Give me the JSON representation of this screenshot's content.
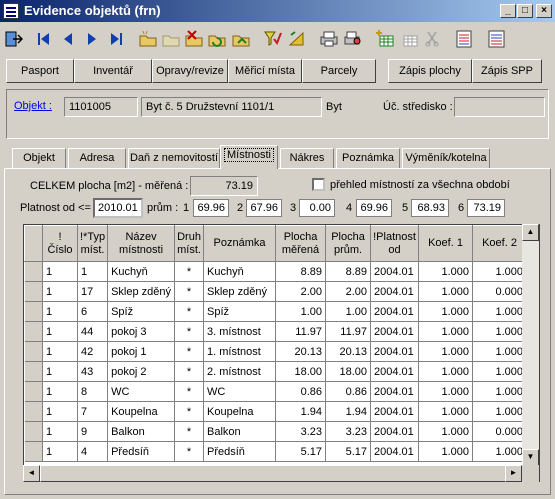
{
  "window": {
    "title": "Evidence objektů (frn)"
  },
  "toolbar": {
    "icons": [
      "exit-icon",
      "first-record-icon",
      "prev-record-icon",
      "next-record-icon",
      "last-record-icon",
      "new-folder-icon",
      "open-folder-icon",
      "delete-folder-icon",
      "refresh-icon",
      "redo-icon",
      "filter-icon",
      "sort-icon",
      "print-icon",
      "print-preview-icon",
      "add-table-icon",
      "table-icon",
      "cut-icon",
      "list-icon",
      "export-icon"
    ]
  },
  "nav_buttons": [
    "Pasport",
    "Inventář",
    "Opravy/revize",
    "Měřicí místa",
    "Parcely",
    "Zápis plochy",
    "Zápis SPP"
  ],
  "object": {
    "label": "Objekt :",
    "code": "1101005",
    "name": "Byt č.  5 Družstevní 1101/1",
    "type": "Byt",
    "cost_center_label": "Úč. středisko :",
    "cost_center_value": ""
  },
  "tabs": [
    "Objekt",
    "Adresa",
    "Daň z nemovitostí",
    "Místnosti",
    "Nákres",
    "Poznámka",
    "Výměník/kotelna"
  ],
  "active_tab": "Místnosti",
  "summary": {
    "total_label": "CELKEM plocha [m2] - měřená :",
    "total_value": "73.19",
    "overview_label": "přehled místností za všechna období",
    "validity_label": "Platnost od <=",
    "validity_value": "2010.01",
    "avg_label": "prům :",
    "averages": [
      {
        "n": "1",
        "v": "69.96"
      },
      {
        "n": "2",
        "v": "67.96"
      },
      {
        "n": "3",
        "v": "0.00"
      },
      {
        "n": "4",
        "v": "69.96"
      },
      {
        "n": "5",
        "v": "68.93"
      },
      {
        "n": "6",
        "v": "73.19"
      }
    ]
  },
  "grid": {
    "columns": [
      "! Číslo",
      "!*Typ míst.",
      "Název místnosti",
      "Druh míst.",
      "Poznámka",
      "Plocha měřená",
      "Plocha prům.",
      "!Platnost od",
      "Koef. 1",
      "Koef. 2"
    ],
    "rows": [
      [
        "1",
        "1",
        "Kuchyň",
        "*",
        "Kuchyň",
        "8.89",
        "8.89",
        "2004.01",
        "1.000",
        "1.000"
      ],
      [
        "1",
        "17",
        "Sklep zděný",
        "*",
        "Sklep zděný",
        "2.00",
        "2.00",
        "2004.01",
        "1.000",
        "0.000"
      ],
      [
        "1",
        "6",
        "Spíž",
        "*",
        "Spíž",
        "1.00",
        "1.00",
        "2004.01",
        "1.000",
        "1.000"
      ],
      [
        "1",
        "44",
        "pokoj 3",
        "*",
        "3. místnost",
        "11.97",
        "11.97",
        "2004.01",
        "1.000",
        "1.000"
      ],
      [
        "1",
        "42",
        "pokoj 1",
        "*",
        "1. místnost",
        "20.13",
        "20.13",
        "2004.01",
        "1.000",
        "1.000"
      ],
      [
        "1",
        "43",
        "pokoj 2",
        "*",
        "2. místnost",
        "18.00",
        "18.00",
        "2004.01",
        "1.000",
        "1.000"
      ],
      [
        "1",
        "8",
        "WC",
        "*",
        "WC",
        "0.86",
        "0.86",
        "2004.01",
        "1.000",
        "1.000"
      ],
      [
        "1",
        "7",
        "Koupelna",
        "*",
        "Koupelna",
        "1.94",
        "1.94",
        "2004.01",
        "1.000",
        "1.000"
      ],
      [
        "1",
        "9",
        "Balkon",
        "*",
        "Balkon",
        "3.23",
        "3.23",
        "2004.01",
        "1.000",
        "0.000"
      ],
      [
        "1",
        "4",
        "Předsíň",
        "*",
        "Předsíň",
        "5.17",
        "5.17",
        "2004.01",
        "1.000",
        "1.000"
      ]
    ]
  }
}
